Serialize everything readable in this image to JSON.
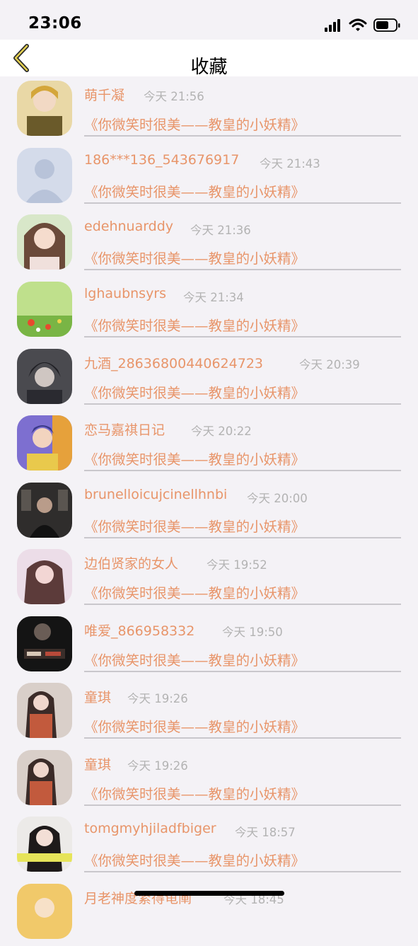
{
  "status": {
    "time": "23:06"
  },
  "nav": {
    "title": "收藏"
  },
  "items": [
    {
      "name": "萌千凝",
      "time": "今天 21:56",
      "book": "《你微笑时很美——教皇的小妖精》"
    },
    {
      "name": "186***136_543676917",
      "time": "今天 21:43",
      "book": "《你微笑时很美——教皇的小妖精》"
    },
    {
      "name": "edehnuarddy",
      "time": "今天 21:36",
      "book": "《你微笑时很美——教皇的小妖精》"
    },
    {
      "name": "lghaubnsyrs",
      "time": "今天 21:34",
      "book": "《你微笑时很美——教皇的小妖精》"
    },
    {
      "name": "九酒_28636800440624723",
      "time": "今天 20:39",
      "book": "《你微笑时很美——教皇的小妖精》"
    },
    {
      "name": "恋马嘉祺日记",
      "time": "今天 20:22",
      "book": "《你微笑时很美——教皇的小妖精》"
    },
    {
      "name": "brunelloicujcinellhnbi",
      "time": "今天 20:00",
      "book": "《你微笑时很美——教皇的小妖精》"
    },
    {
      "name": "边伯贤家的女人",
      "time": "今天 19:52",
      "book": "《你微笑时很美——教皇的小妖精》"
    },
    {
      "name": "唯爱_866958332",
      "time": "今天 19:50",
      "book": "《你微笑时很美——教皇的小妖精》"
    },
    {
      "name": "童琪",
      "time": "今天 19:26",
      "book": "《你微笑时很美——教皇的小妖精》"
    },
    {
      "name": "童琪",
      "time": "今天 19:26",
      "book": "《你微笑时很美——教皇的小妖精》"
    },
    {
      "name": "tomgmyhjiladfbiger",
      "time": "今天 18:57",
      "book": "《你微笑时很美——教皇的小妖精》"
    },
    {
      "name": "月老神度紧得龟阐",
      "time": "今天 18:45",
      "book": ""
    }
  ]
}
